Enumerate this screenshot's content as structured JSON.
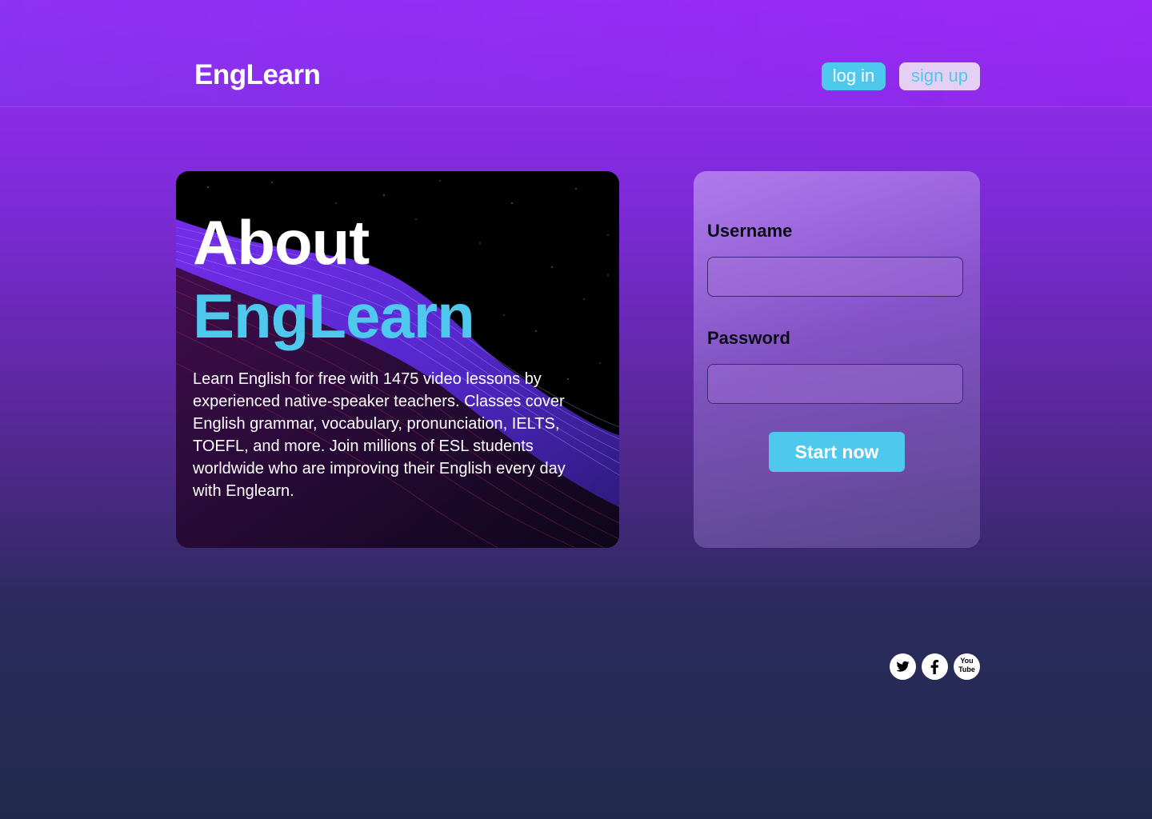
{
  "header": {
    "logo": "EngLearn",
    "login_label": "log in",
    "signup_label": "sign up"
  },
  "about": {
    "title": "About",
    "brand": "EngLearn",
    "text": "Learn English for free with 1475 video lessons by experienced native-speaker teachers. Classes cover English grammar, vocabulary, pronunciation, IELTS, TOEFL, and more. Join millions of ESL students worldwide who are improving their English every day with Englearn."
  },
  "login_form": {
    "username_label": "Username",
    "username_value": "",
    "password_label": "Password",
    "password_value": "",
    "submit_label": "Start now"
  },
  "social": {
    "youtube_line1": "You",
    "youtube_line2": "Tube",
    "icons": [
      "twitter-icon",
      "facebook-icon",
      "youtube-icon"
    ]
  },
  "colors": {
    "accent": "#4fc8ee",
    "signup_bg": "#e5d0f5",
    "gradient_top": "#9a2cf5",
    "gradient_bottom": "#212a4c"
  }
}
